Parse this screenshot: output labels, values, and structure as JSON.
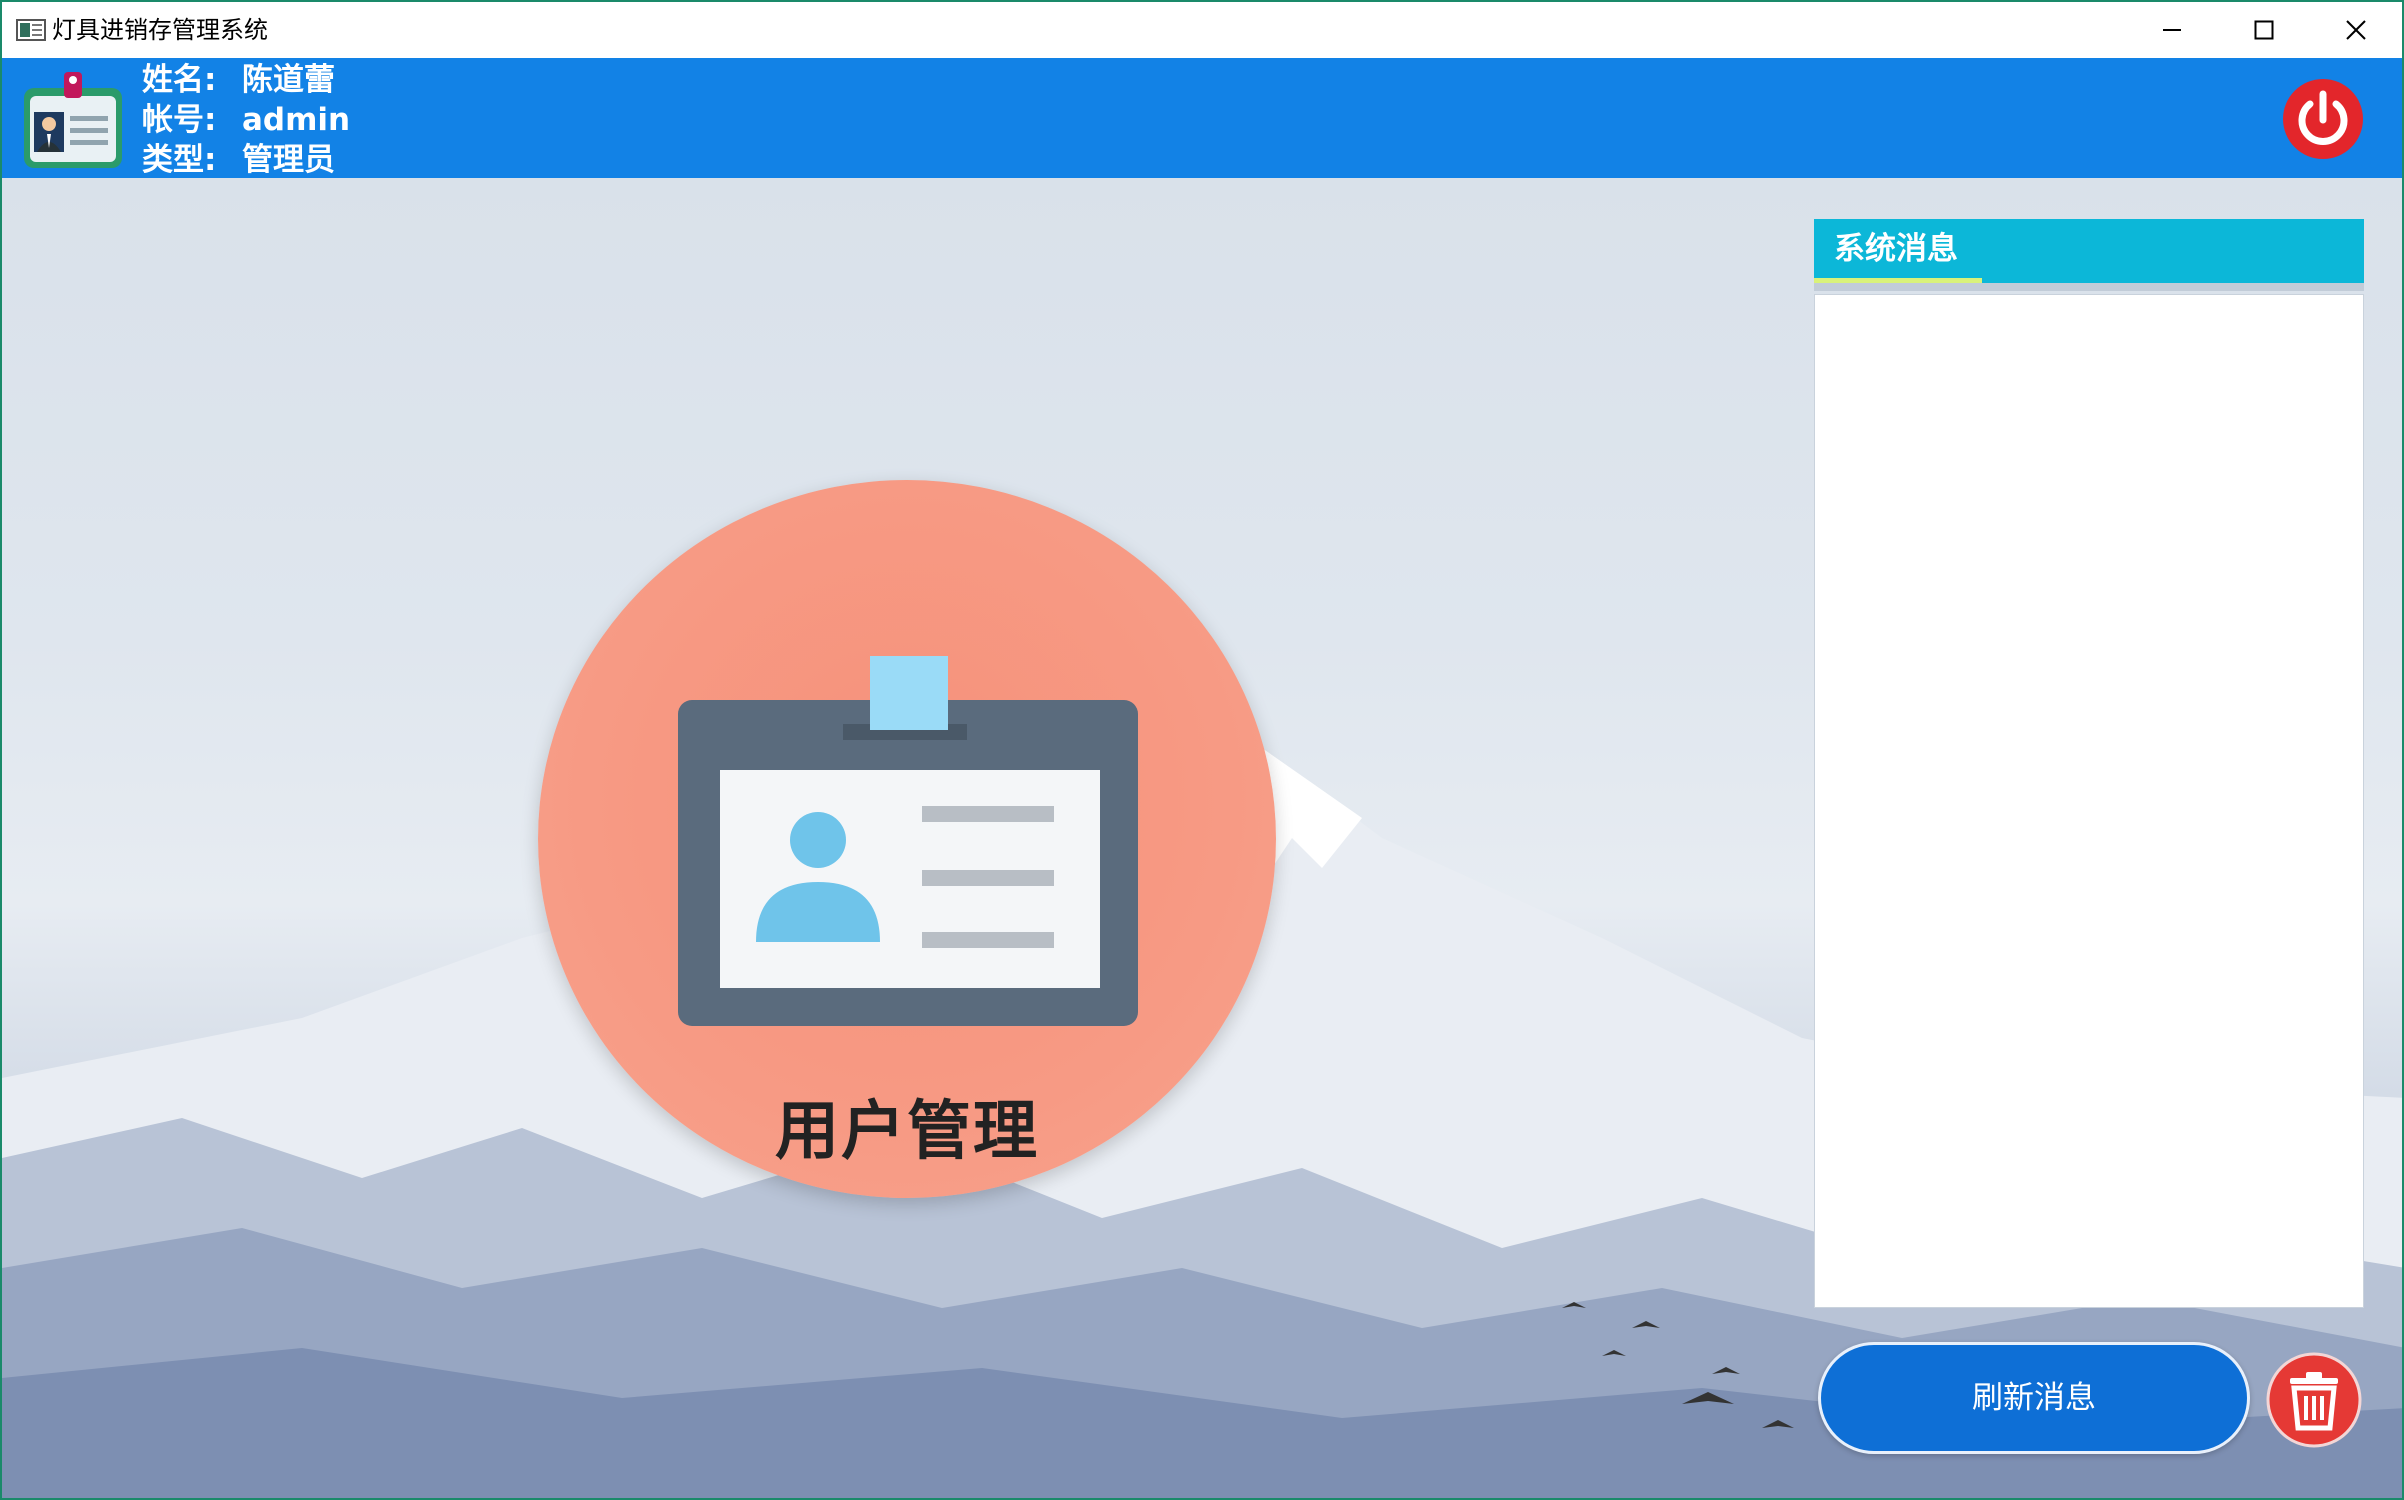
{
  "window": {
    "title": "灯具进销存管理系统"
  },
  "user": {
    "name_label": "姓名:",
    "name_value": "陈道蕾",
    "account_label": "帐号:",
    "account_value": "admin",
    "type_label": "类型:",
    "type_value": "管理员"
  },
  "main": {
    "user_mgmt_label": "用户管理"
  },
  "messages": {
    "title": "系统消息",
    "refresh_label": "刷新消息"
  },
  "colors": {
    "header": "#1282e6",
    "circle": "#f79a84",
    "msg_header": "#0cb7d8",
    "refresh": "#0e6fd6",
    "danger": "#e53935"
  }
}
